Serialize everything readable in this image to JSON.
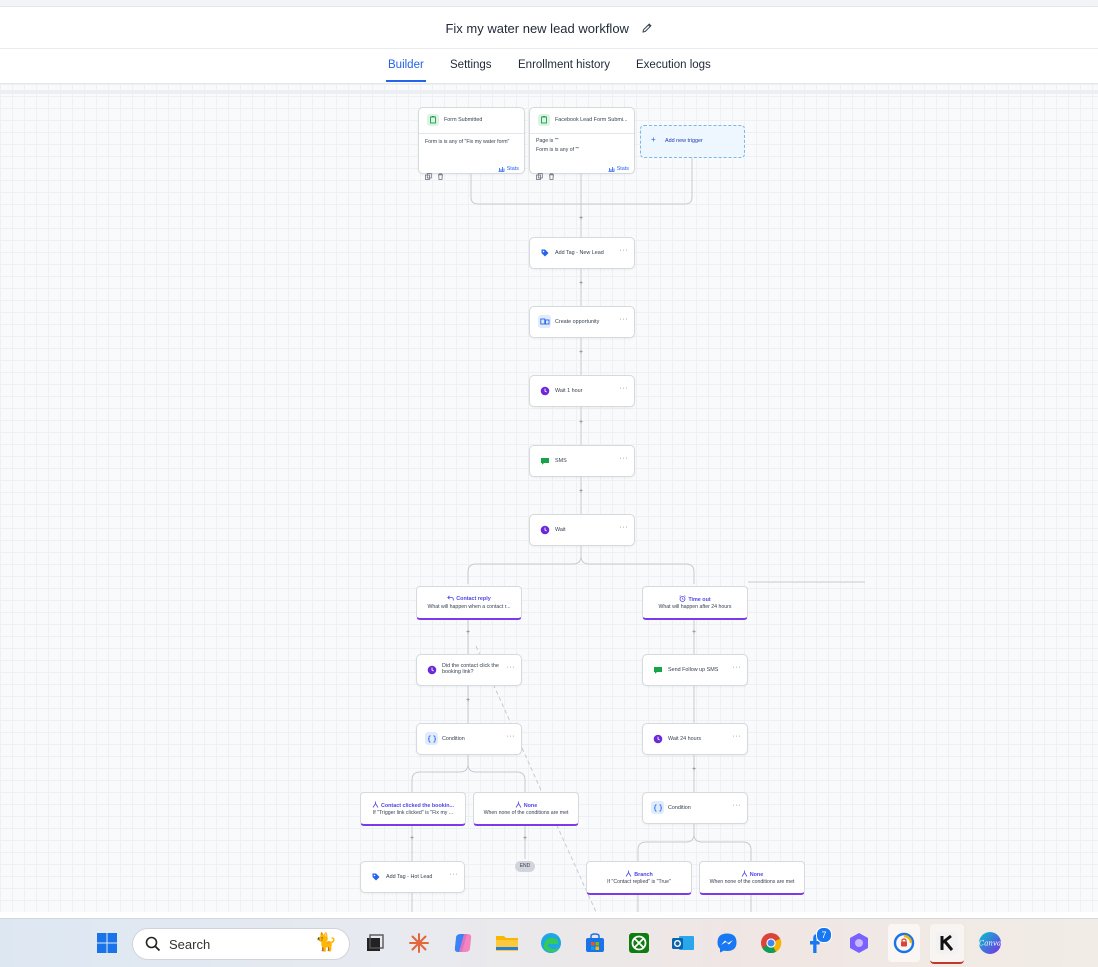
{
  "header": {
    "title": "Fix my water new lead workflow"
  },
  "tabs": [
    {
      "label": "Builder"
    },
    {
      "label": "Settings"
    },
    {
      "label": "Enrollment history"
    },
    {
      "label": "Execution logs"
    }
  ],
  "triggers": [
    {
      "title": "Form Submitted",
      "lines": [
        "Form is is any of \"Fix my water form\""
      ],
      "stats": "Stats"
    },
    {
      "title": "Facebook Lead Form Submi...",
      "lines": [
        "Page is \"\"",
        "Form is is any of \"\""
      ],
      "stats": "Stats"
    }
  ],
  "add_trigger": {
    "label": "Add new trigger"
  },
  "main_actions": [
    {
      "label": "Add Tag - New Lead",
      "icon": "tag-icon"
    },
    {
      "label": "Create opportunity",
      "icon": "opportunity-icon"
    },
    {
      "label": "Wait 1 hour",
      "icon": "clock-icon"
    },
    {
      "label": "SMS",
      "icon": "sms-icon"
    },
    {
      "label": "Wait",
      "icon": "clock-icon"
    }
  ],
  "left_branch": {
    "header": {
      "title": "Contact reply",
      "subtitle": "What will happen when a contact r..."
    },
    "actions": [
      {
        "label": "Did the contact click the booking link?"
      },
      {
        "label": "Condition"
      }
    ],
    "sub_branches": [
      {
        "title": "Contact clicked the bookin...",
        "subtitle": "If \"Trigger link clicked\" is \"Fix my ..."
      },
      {
        "title": "None",
        "subtitle": "When none of the conditions are met"
      }
    ],
    "after": {
      "label": "Add Tag - Hot Lead"
    },
    "end": "END"
  },
  "right_branch": {
    "header": {
      "title": "Time out",
      "subtitle": "What will happen after 24 hours"
    },
    "actions": [
      {
        "label": "Send Follow up SMS"
      },
      {
        "label": "Wait 24 hours"
      },
      {
        "label": "Condition"
      }
    ],
    "sub_branches": [
      {
        "title": "Branch",
        "subtitle": "If \"Contact replied\" is \"True\""
      },
      {
        "title": "None",
        "subtitle": "When none of the conditions are met"
      }
    ]
  },
  "taskbar": {
    "search_placeholder": "Search",
    "notification_count": "7"
  },
  "colors": {
    "accent": "#2563eb",
    "branch": "#7c3aed",
    "tag": "#2563eb",
    "wait": "#6d28d9",
    "sms": "#16a34a"
  }
}
